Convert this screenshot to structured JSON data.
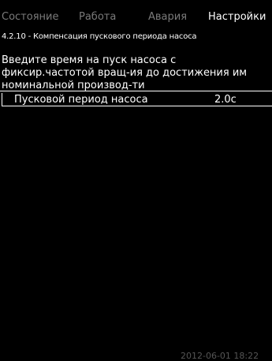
{
  "tabs": [
    {
      "label": "Состояние",
      "active": false
    },
    {
      "label": "Работа",
      "active": false
    },
    {
      "label": "Авария",
      "active": false
    },
    {
      "label": "Настройки",
      "active": true
    }
  ],
  "breadcrumb": "4.2.10 - Компенсация пускового периода насоса",
  "description": [
    "Введите время на пуск насоса с",
    "фиксир.частотой вращ-ия до достижения им",
    "номинальной производ-ти"
  ],
  "parameter": {
    "label": "Пусковой период насоса",
    "value": "2.0с"
  },
  "timestamp": "2012-06-01 18:22",
  "colors": {
    "background": "#000000",
    "text": "#ffffff",
    "inactive_tab": "#7a7a7a"
  }
}
